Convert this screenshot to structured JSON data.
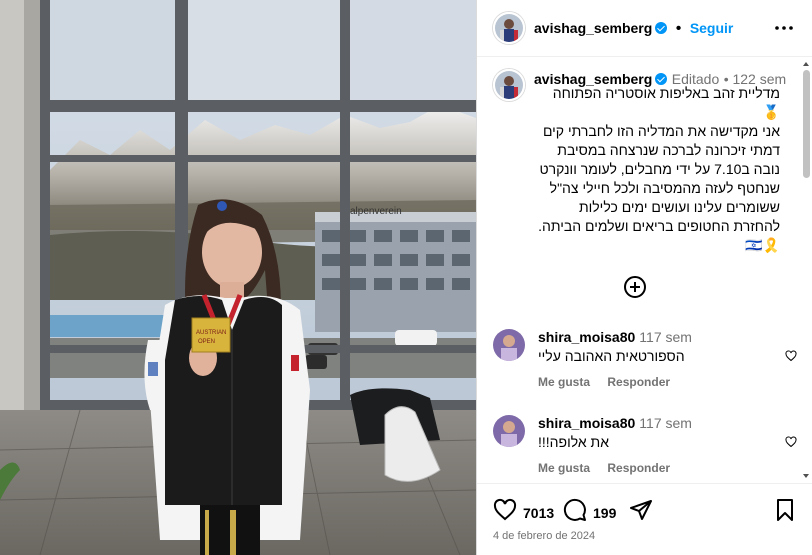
{
  "post": {
    "username": "avishag_semberg",
    "follow_label": "Seguir",
    "caption": {
      "edited_label": "Editado",
      "age": "122 sem",
      "text": "מדליית זהב באליפות אוסטריה הפתוחה 🥇\nאני מקדישה את המדליה הזו לחברתי קים דמתי זיכרונה לברכה שנרצחה במסיבת נובה ב7.10 על ידי מחבלים, לעומר וונקרט שנחטף לעזה מהמסיבה ולכל חיילי צה\"ל ששומרים עלינו ועושים ימים כלילות להחזרת החטופים בריאים ושלמים הביתה.🎗️🇮🇱"
    },
    "likes": "7013",
    "comments_count": "199",
    "date": "4 de febrero de 2024"
  },
  "comments": [
    {
      "username": "shira_moisa80",
      "age": "117 sem",
      "text": "הספורטאית האהובה עליי",
      "like_label": "Me gusta",
      "reply_label": "Responder"
    },
    {
      "username": "shira_moisa80",
      "age": "117 sem",
      "text": "את אלופה!!!",
      "like_label": "Me gusta",
      "reply_label": "Responder"
    }
  ],
  "photo_sign_text": "alpenverein",
  "icons": {
    "like": "heart-icon",
    "comment": "comment-icon",
    "share": "share-icon",
    "save": "bookmark-icon",
    "more": "more-options-icon",
    "verified": "verified-badge-icon",
    "add": "add-circle-icon"
  },
  "colors": {
    "link": "#0095f6",
    "meta": "#737373",
    "divider": "#efefef"
  }
}
